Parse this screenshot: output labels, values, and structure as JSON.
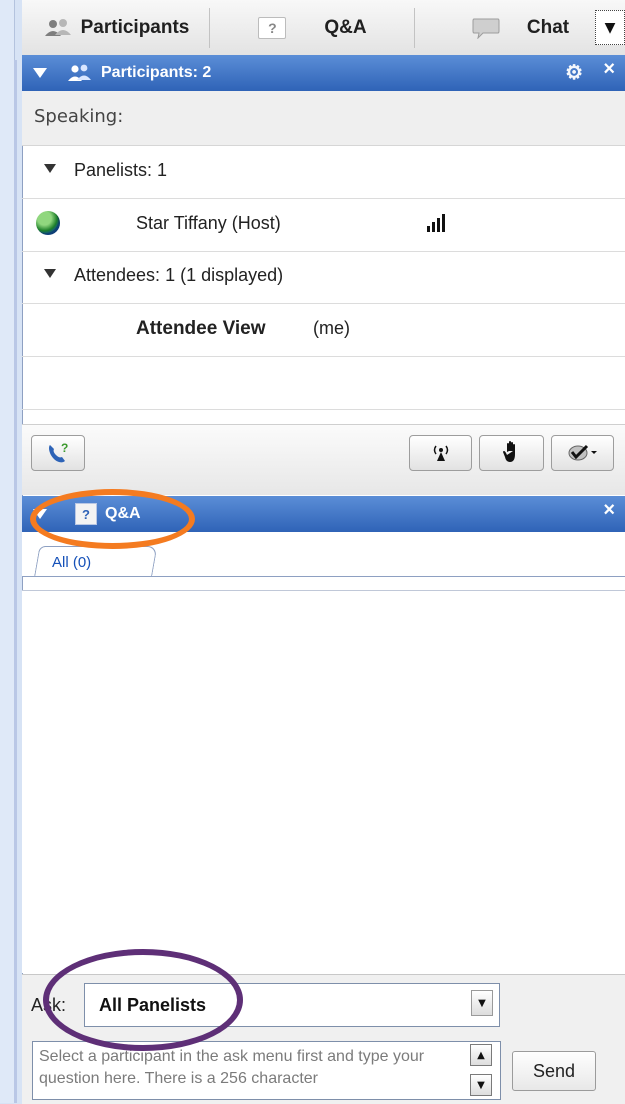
{
  "tabs": {
    "participants_label": "Participants",
    "qa_label": "Q&A",
    "chat_label": "Chat"
  },
  "participants_panel": {
    "header_title": "Participants: 2",
    "speaking_label": "Speaking:",
    "panelists_label": "Panelists: 1",
    "host_name": "Star Tiffany (Host)",
    "attendees_label": "Attendees: 1 (1 displayed)",
    "attendee_name": "Attendee View",
    "attendee_suffix": "(me)"
  },
  "qa_panel": {
    "header_title": "Q&A",
    "tab_all": "All (0)",
    "ask_label": "Ask:",
    "ask_selected": "All Panelists",
    "question_placeholder": "Select a participant in the ask menu first and type your question here. There is a 256 character",
    "send_label": "Send"
  },
  "icons": {
    "participants_icon": "people-icon",
    "qa_icon": "question-icon",
    "chat_icon": "speech-bubble-icon",
    "host_status": "globe-icon",
    "signal": "signal-bars-icon"
  },
  "colors": {
    "header_blue": "#2f63b7",
    "highlight_orange": "#f47b20",
    "highlight_purple": "#5e2f77"
  }
}
